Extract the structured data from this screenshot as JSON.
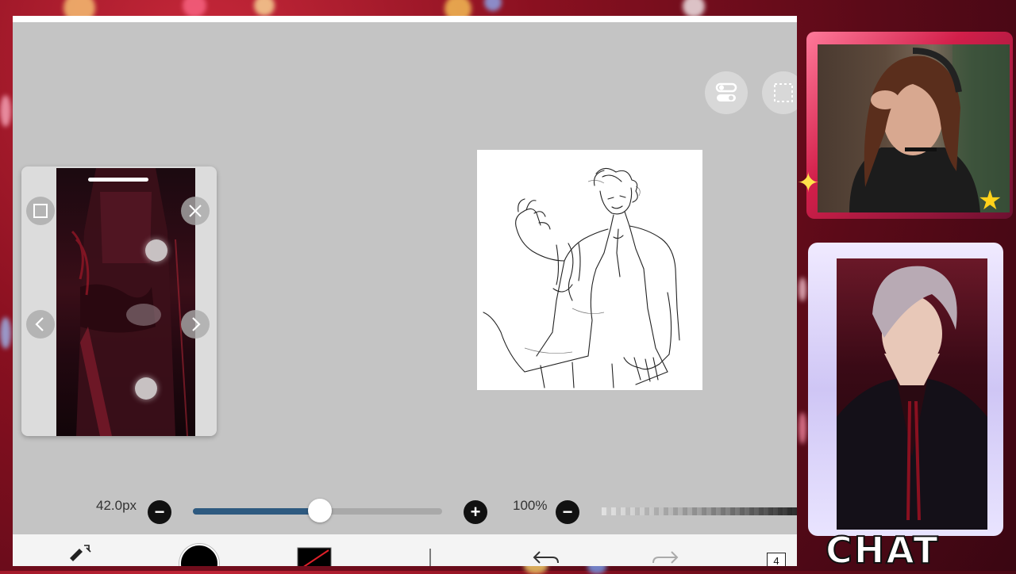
{
  "app": {
    "brush_size_label": "42.0px",
    "brush_size_fraction": 0.51,
    "opacity_label": "100%",
    "opacity_fraction": 1.0,
    "layer_count": "4",
    "icons": {
      "top_controls": [
        "toggle-switches-icon",
        "selection-icon"
      ],
      "toolbar": [
        "brush-tool-icon",
        "color-icon",
        "layer-swatch-icon",
        "layer-divider-icon",
        "undo-icon",
        "redo-icon",
        "layer-count-icon"
      ]
    }
  },
  "reference_window": {
    "icons": [
      "expand-icon",
      "close-icon",
      "prev-arrow-icon",
      "next-arrow-icon"
    ]
  },
  "overlay": {
    "chat_logo": "CHAT"
  },
  "colors": {
    "slider_fill": "#2e5a80",
    "background_red": "#8a1020",
    "primary_color": "#000000"
  }
}
